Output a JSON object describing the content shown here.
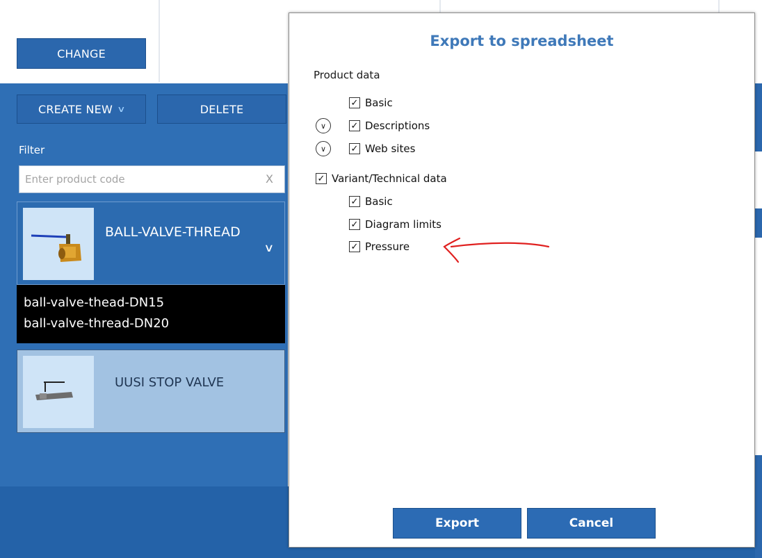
{
  "header": {
    "change_label": "CHANGE"
  },
  "toolbar": {
    "create_new_label": "CREATE NEW",
    "delete_label": "DELETE"
  },
  "filter": {
    "label": "Filter",
    "placeholder": "Enter product code",
    "clear_label": "X"
  },
  "products": [
    {
      "title": "BALL-VALVE-THREAD",
      "expanded": true,
      "variants": [
        "ball-valve-thead-DN15",
        "ball-valve-thread-DN20"
      ]
    },
    {
      "title": "UUSI STOP VALVE",
      "expanded": false
    }
  ],
  "dialog": {
    "title": "Export to spreadsheet",
    "product_section_label": "Product data",
    "product_items": [
      {
        "label": "Basic",
        "checked": true,
        "expandable": false
      },
      {
        "label": "Descriptions",
        "checked": true,
        "expandable": true
      },
      {
        "label": "Web sites",
        "checked": true,
        "expandable": true
      }
    ],
    "variant_section": {
      "label": "Variant/Technical data",
      "checked": true
    },
    "variant_items": [
      {
        "label": "Basic",
        "checked": true
      },
      {
        "label": "Diagram limits",
        "checked": true
      },
      {
        "label": "Pressure",
        "checked": true
      }
    ],
    "export_label": "Export",
    "cancel_label": "Cancel"
  },
  "annotation": {
    "color": "#e0201f",
    "target": "Pressure"
  },
  "colors": {
    "accent": "#2b67ad",
    "dialog_title": "#3f79b9",
    "panel": "#2f6fb5"
  }
}
